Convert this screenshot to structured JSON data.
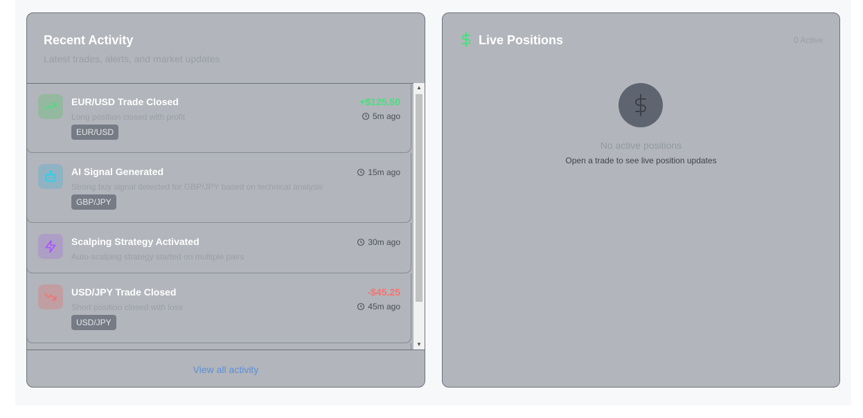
{
  "activity": {
    "title": "Recent Activity",
    "subtitle": "Latest trades, alerts, and market updates",
    "items": [
      {
        "title": "EUR/USD Trade Closed",
        "description": "Long position closed with profit",
        "tag": "EUR/USD",
        "amount": "+$125.50",
        "time": "5m ago",
        "icon": "trending-up-icon"
      },
      {
        "title": "AI Signal Generated",
        "description": "Strong buy signal detected for GBP/JPY based on technical analysis",
        "tag": "GBP/JPY",
        "time": "15m ago",
        "icon": "bot-icon"
      },
      {
        "title": "Scalping Strategy Activated",
        "description": "Auto-scalping strategy started on multiple pairs",
        "time": "30m ago",
        "icon": "zap-icon"
      },
      {
        "title": "USD/JPY Trade Closed",
        "description": "Short position closed with loss",
        "tag": "USD/JPY",
        "amount": "-$45.25",
        "time": "45m ago",
        "icon": "trending-down-icon"
      }
    ],
    "view_all": "View all activity"
  },
  "positions": {
    "title": "Live Positions",
    "count": "0 Active",
    "empty_title": "No active positions",
    "empty_subtitle": "Open a trade to see live position updates",
    "icon": "dollar-icon"
  },
  "colors": {
    "profit": "#4ade80",
    "loss": "#f87171",
    "link": "#5b8fd6"
  }
}
